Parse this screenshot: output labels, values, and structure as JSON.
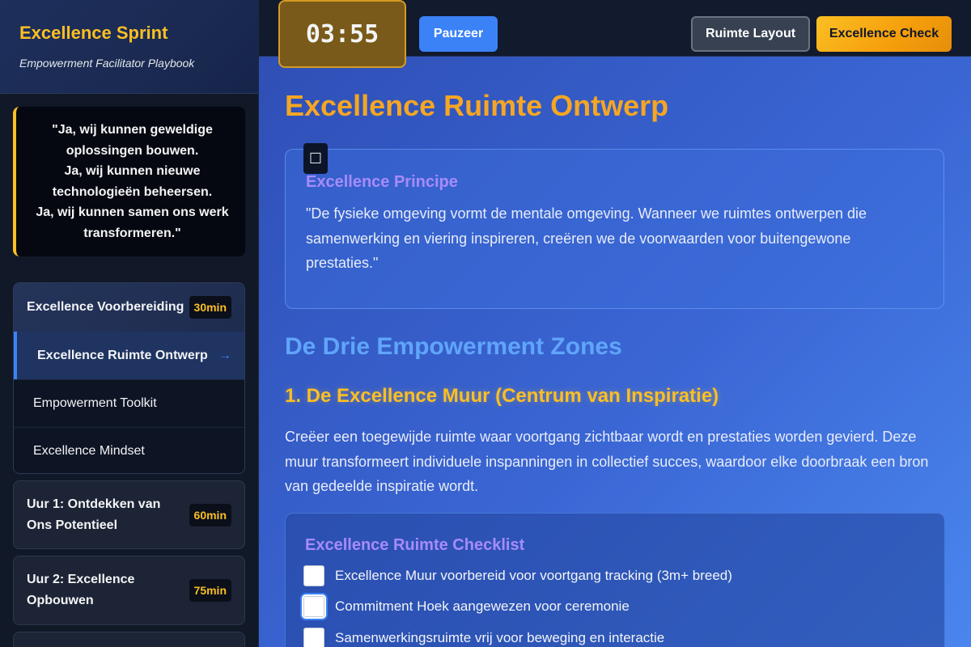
{
  "sidebar": {
    "title": "Excellence Sprint",
    "subtitle": "Empowerment Facilitator Playbook",
    "quote": [
      "\"Ja, wij kunnen geweldige",
      "oplossingen bouwen.",
      "Ja, wij kunnen nieuwe",
      "technologieën beheersen.",
      "Ja, wij kunnen samen ons werk",
      "transformeren.\""
    ],
    "phase": {
      "label": "Excellence Voorbereiding",
      "duration": "30min",
      "items": [
        {
          "label": "Excellence Ruimte Ontwerp",
          "arrow": "→"
        },
        {
          "label": "Empowerment Toolkit"
        },
        {
          "label": "Excellence Mindset"
        }
      ]
    },
    "cards": [
      {
        "label": "Uur 1: Ontdekken van Ons Potentieel",
        "duration": "60min"
      },
      {
        "label": "Uur 2: Excellence Opbouwen",
        "duration": "75min"
      }
    ]
  },
  "topbar": {
    "timer": "03:55",
    "pause_label": "Pauzeer",
    "layout_label": "Ruimte Layout",
    "check_label": "Excellence Check"
  },
  "main": {
    "title": "Excellence Ruimte Ontwerp",
    "principle": {
      "icon": "bookmark-icon",
      "title": "Excellence Principe",
      "text": "\"De fysieke omgeving vormt de mentale omgeving. Wanneer we ruimtes ontwerpen die samenwerking en viering inspireren, creëren we de voorwaarden voor buitengewone prestaties.\""
    },
    "zones_title": "De Drie Empowerment Zones",
    "zone1": {
      "title": "1. De Excellence Muur (Centrum van Inspiratie)",
      "text": "Creëer een toegewijde ruimte waar voortgang zichtbaar wordt en prestaties worden gevierd. Deze muur transformeert individuele inspanningen in collectief succes, waardoor elke doorbraak een bron van gedeelde inspiratie wordt."
    },
    "checklist": {
      "title": "Excellence Ruimte Checklist",
      "items": [
        {
          "label": "Excellence Muur voorbereid voor voortgang tracking (3m+ breed)",
          "checked": false
        },
        {
          "label": "Commitment Hoek aangewezen voor ceremonie",
          "checked": false
        },
        {
          "label": "Samenwerkingsruimte vrij voor beweging en interactie",
          "checked": false
        }
      ]
    }
  }
}
